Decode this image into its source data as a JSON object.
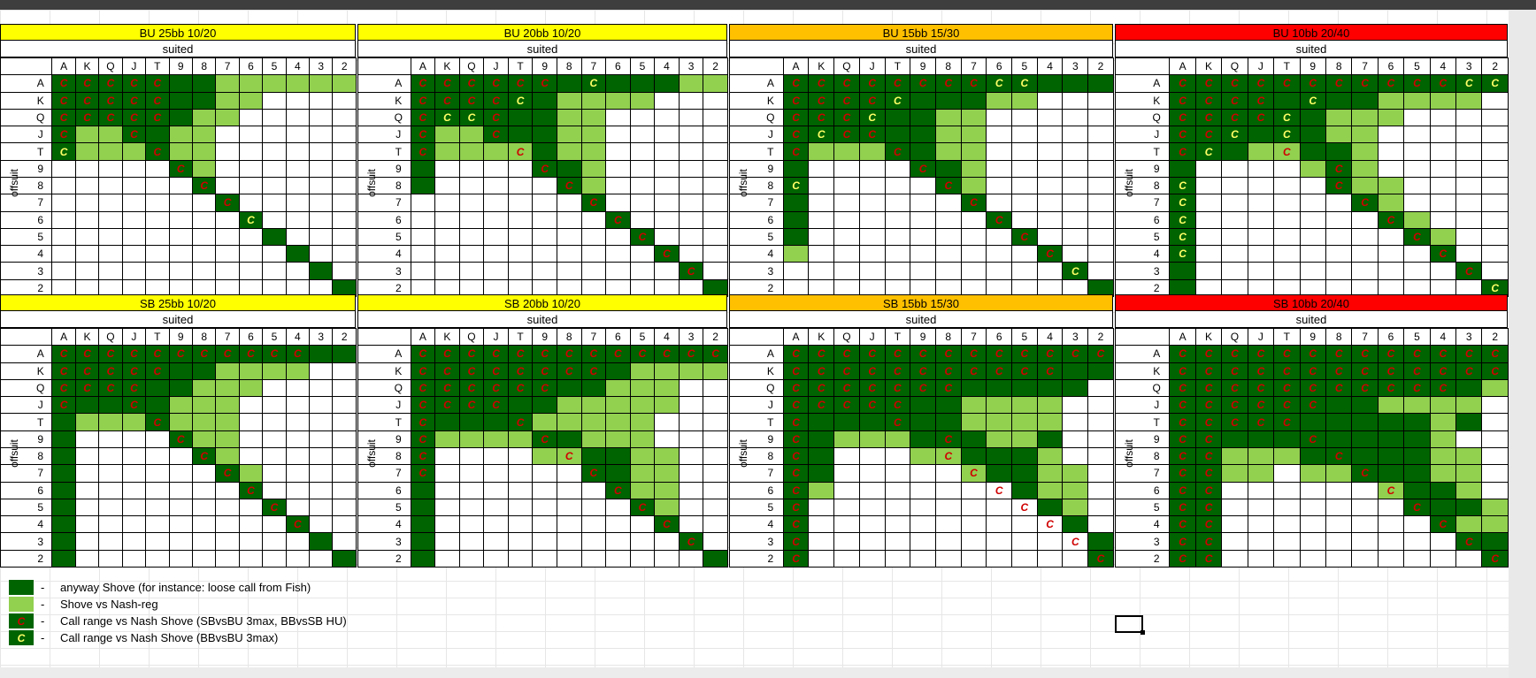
{
  "ranks": [
    "A",
    "K",
    "Q",
    "J",
    "T",
    "9",
    "8",
    "7",
    "6",
    "5",
    "4",
    "3",
    "2"
  ],
  "colors": {
    "yellow": "#ffff00",
    "orange": "#ffc000",
    "red": "#ff0000",
    "dark": "#006400",
    "light": "#92d050"
  },
  "labels": {
    "suited": "suited",
    "offsuit": "offsuit"
  },
  "panels": [
    {
      "title": "BU 25bb 10/20",
      "color": "yellow",
      "rows": [
        "DDDDDDDLLLLLL",
        "DDDDDDDLL....",
        "DDDDDDLL.....",
        "DLLDDLL......",
        "DLLLDLL......",
        ".....DL......",
        "......D......",
        ".......D.....",
        "........D....",
        ".........D...",
        "..........D..",
        "...........D.",
        "............D"
      ],
      "red": [
        [
          0,
          0
        ],
        [
          0,
          1
        ],
        [
          0,
          2
        ],
        [
          0,
          3
        ],
        [
          0,
          4
        ],
        [
          1,
          0
        ],
        [
          1,
          1
        ],
        [
          1,
          2
        ],
        [
          1,
          3
        ],
        [
          1,
          4
        ],
        [
          2,
          0
        ],
        [
          2,
          1
        ],
        [
          2,
          2
        ],
        [
          2,
          3
        ],
        [
          2,
          4
        ],
        [
          3,
          0
        ],
        [
          3,
          3
        ],
        [
          4,
          4
        ],
        [
          5,
          5
        ],
        [
          6,
          6
        ],
        [
          7,
          7
        ]
      ],
      "yel": [
        [
          4,
          0
        ],
        [
          8,
          8
        ]
      ]
    },
    {
      "title": "BU 20bb 10/20",
      "color": "yellow",
      "rows": [
        "DDDDDDDDDDDLL",
        "DDDDDDLLLL...",
        "DDDDDDLL.....",
        "DLLDDDLL.....",
        "DLLLLDLL.....",
        "D....DDL.....",
        "D.....DL.....",
        ".......D.....",
        "........D....",
        ".........D...",
        "..........D..",
        "...........D.",
        "............D"
      ],
      "red": [
        [
          0,
          0
        ],
        [
          0,
          1
        ],
        [
          0,
          2
        ],
        [
          0,
          3
        ],
        [
          0,
          4
        ],
        [
          0,
          5
        ],
        [
          1,
          0
        ],
        [
          1,
          1
        ],
        [
          1,
          2
        ],
        [
          1,
          3
        ],
        [
          2,
          0
        ],
        [
          2,
          3
        ],
        [
          3,
          0
        ],
        [
          3,
          3
        ],
        [
          4,
          0
        ],
        [
          4,
          4
        ],
        [
          5,
          5
        ],
        [
          6,
          6
        ],
        [
          7,
          7
        ],
        [
          8,
          8
        ],
        [
          9,
          9
        ],
        [
          10,
          10
        ],
        [
          11,
          11
        ]
      ],
      "yel": [
        [
          0,
          7
        ],
        [
          1,
          4
        ],
        [
          2,
          1
        ],
        [
          2,
          2
        ]
      ]
    },
    {
      "title": "BU 15bb 15/30",
      "color": "orange",
      "rows": [
        "DDDDDDDDDDDDD",
        "DDDDDDDDLL...",
        "DDDDDDLL.....",
        "DDDDDDLL.....",
        "DLLLDDLL.....",
        "D....DDL.....",
        "D.....DL.....",
        "D......D.....",
        "D.......D....",
        "D........D...",
        "L.........D..",
        "...........D.",
        "............D"
      ],
      "red": [
        [
          0,
          0
        ],
        [
          0,
          1
        ],
        [
          0,
          2
        ],
        [
          0,
          3
        ],
        [
          0,
          4
        ],
        [
          0,
          5
        ],
        [
          0,
          6
        ],
        [
          0,
          7
        ],
        [
          1,
          0
        ],
        [
          1,
          1
        ],
        [
          1,
          2
        ],
        [
          1,
          3
        ],
        [
          2,
          0
        ],
        [
          2,
          1
        ],
        [
          2,
          2
        ],
        [
          3,
          0
        ],
        [
          3,
          2
        ],
        [
          3,
          3
        ],
        [
          4,
          0
        ],
        [
          4,
          4
        ],
        [
          5,
          5
        ],
        [
          6,
          6
        ],
        [
          7,
          7
        ],
        [
          8,
          8
        ],
        [
          9,
          9
        ],
        [
          10,
          10
        ]
      ],
      "yel": [
        [
          0,
          8
        ],
        [
          0,
          9
        ],
        [
          1,
          4
        ],
        [
          2,
          3
        ],
        [
          3,
          1
        ],
        [
          6,
          0
        ],
        [
          11,
          11
        ]
      ]
    },
    {
      "title": "BU 10bb 20/40",
      "color": "red",
      "rows": [
        "DDDDDDDDDDDDD",
        "DDDDDDDDLLLL.",
        "DDDDDDLLL....",
        "DDDDDDLL.....",
        "DDDLLDDL.....",
        "D....LDL.....",
        "D.....DLL....",
        "D......DL....",
        "D.......DL...",
        "D........DL..",
        "D.........D..",
        "D..........D.",
        "D...........D"
      ],
      "red": [
        [
          0,
          0
        ],
        [
          0,
          1
        ],
        [
          0,
          2
        ],
        [
          0,
          3
        ],
        [
          0,
          4
        ],
        [
          0,
          5
        ],
        [
          0,
          6
        ],
        [
          0,
          7
        ],
        [
          0,
          8
        ],
        [
          0,
          9
        ],
        [
          0,
          10
        ],
        [
          1,
          0
        ],
        [
          1,
          1
        ],
        [
          1,
          2
        ],
        [
          1,
          3
        ],
        [
          2,
          0
        ],
        [
          2,
          1
        ],
        [
          2,
          2
        ],
        [
          2,
          3
        ],
        [
          3,
          0
        ],
        [
          3,
          1
        ],
        [
          4,
          0
        ],
        [
          4,
          4
        ],
        [
          5,
          6
        ],
        [
          6,
          6
        ],
        [
          7,
          7
        ],
        [
          8,
          8
        ],
        [
          9,
          9
        ],
        [
          10,
          10
        ],
        [
          11,
          11
        ]
      ],
      "yel": [
        [
          0,
          11
        ],
        [
          0,
          12
        ],
        [
          1,
          5
        ],
        [
          2,
          4
        ],
        [
          3,
          2
        ],
        [
          3,
          4
        ],
        [
          4,
          1
        ],
        [
          6,
          0
        ],
        [
          7,
          0
        ],
        [
          8,
          0
        ],
        [
          9,
          0
        ],
        [
          10,
          0
        ],
        [
          12,
          12
        ]
      ]
    },
    {
      "title": "SB 25bb 10/20",
      "color": "yellow",
      "rows": [
        "DDDDDDDDDDDDD",
        "DDDDDDDLLLL..",
        "DDDDDDLLL....",
        "DDDDDLLL.....",
        "DLLLDLLL.....",
        "D....DLL.....",
        "D.....DL.....",
        "D......DL....",
        "D.......D....",
        "D........D...",
        "D.........D..",
        "D..........D.",
        "D...........D"
      ],
      "red": [
        [
          0,
          0
        ],
        [
          0,
          1
        ],
        [
          0,
          2
        ],
        [
          0,
          3
        ],
        [
          0,
          4
        ],
        [
          0,
          5
        ],
        [
          0,
          6
        ],
        [
          0,
          7
        ],
        [
          0,
          8
        ],
        [
          0,
          9
        ],
        [
          0,
          10
        ],
        [
          1,
          0
        ],
        [
          1,
          1
        ],
        [
          1,
          2
        ],
        [
          1,
          3
        ],
        [
          1,
          4
        ],
        [
          2,
          0
        ],
        [
          2,
          1
        ],
        [
          2,
          2
        ],
        [
          2,
          3
        ],
        [
          3,
          0
        ],
        [
          3,
          3
        ],
        [
          4,
          4
        ],
        [
          5,
          5
        ],
        [
          6,
          6
        ],
        [
          7,
          7
        ],
        [
          8,
          8
        ],
        [
          9,
          9
        ],
        [
          10,
          10
        ]
      ],
      "yel": []
    },
    {
      "title": "SB 20bb 10/20",
      "color": "yellow",
      "rows": [
        "DDDDDDDDDDDDD",
        "DDDDDDDDDLLLL",
        "DDDDDDDDLLL..",
        "DDDDDDLLLLL..",
        "DDDDDLLLLL...",
        "DLLLLDDLLL...",
        "D....LLDDLL..",
        "D......DDLL..",
        "D.......DLL..",
        "D........DL..",
        "D.........D..",
        "D..........D.",
        "D...........D"
      ],
      "red": [
        [
          0,
          0
        ],
        [
          0,
          1
        ],
        [
          0,
          2
        ],
        [
          0,
          3
        ],
        [
          0,
          4
        ],
        [
          0,
          5
        ],
        [
          0,
          6
        ],
        [
          0,
          7
        ],
        [
          0,
          8
        ],
        [
          0,
          9
        ],
        [
          0,
          10
        ],
        [
          0,
          11
        ],
        [
          0,
          12
        ],
        [
          1,
          0
        ],
        [
          1,
          1
        ],
        [
          1,
          2
        ],
        [
          1,
          3
        ],
        [
          1,
          4
        ],
        [
          1,
          5
        ],
        [
          1,
          6
        ],
        [
          1,
          7
        ],
        [
          2,
          0
        ],
        [
          2,
          1
        ],
        [
          2,
          2
        ],
        [
          2,
          3
        ],
        [
          2,
          4
        ],
        [
          2,
          5
        ],
        [
          3,
          0
        ],
        [
          3,
          1
        ],
        [
          3,
          2
        ],
        [
          3,
          3
        ],
        [
          4,
          0
        ],
        [
          4,
          4
        ],
        [
          5,
          0
        ],
        [
          5,
          5
        ],
        [
          6,
          0
        ],
        [
          6,
          6
        ],
        [
          7,
          0
        ],
        [
          7,
          7
        ],
        [
          8,
          8
        ],
        [
          9,
          9
        ],
        [
          10,
          10
        ],
        [
          11,
          11
        ]
      ],
      "yel": []
    },
    {
      "title": "SB 15bb 15/30",
      "color": "orange",
      "rows": [
        "DDDDDDDDDDDDD",
        "DDDDDDDDDDDDD",
        "DDDDDDDDDDDD.",
        "DDDDDDDLLLL..",
        "DDDDDDDLLLL..",
        "DDLLLDDDLLD..",
        "DD...LLDDDL..",
        "DD.....LDDLL.",
        "DL.......DLL.",
        "D.........DL.",
        "D..........D.",
        "D...........D",
        "D...........D"
      ],
      "red": [
        [
          0,
          0
        ],
        [
          0,
          1
        ],
        [
          0,
          2
        ],
        [
          0,
          3
        ],
        [
          0,
          4
        ],
        [
          0,
          5
        ],
        [
          0,
          6
        ],
        [
          0,
          7
        ],
        [
          0,
          8
        ],
        [
          0,
          9
        ],
        [
          0,
          10
        ],
        [
          0,
          11
        ],
        [
          0,
          12
        ],
        [
          1,
          0
        ],
        [
          1,
          1
        ],
        [
          1,
          2
        ],
        [
          1,
          3
        ],
        [
          1,
          4
        ],
        [
          1,
          5
        ],
        [
          1,
          6
        ],
        [
          1,
          7
        ],
        [
          1,
          8
        ],
        [
          1,
          9
        ],
        [
          1,
          10
        ],
        [
          2,
          0
        ],
        [
          2,
          1
        ],
        [
          2,
          2
        ],
        [
          2,
          3
        ],
        [
          2,
          4
        ],
        [
          2,
          5
        ],
        [
          2,
          6
        ],
        [
          3,
          0
        ],
        [
          3,
          1
        ],
        [
          3,
          2
        ],
        [
          3,
          3
        ],
        [
          3,
          4
        ],
        [
          4,
          0
        ],
        [
          4,
          4
        ],
        [
          5,
          0
        ],
        [
          5,
          6
        ],
        [
          6,
          0
        ],
        [
          6,
          6
        ],
        [
          7,
          0
        ],
        [
          7,
          7
        ],
        [
          8,
          0
        ],
        [
          8,
          8
        ],
        [
          9,
          0
        ],
        [
          9,
          9
        ],
        [
          10,
          0
        ],
        [
          10,
          10
        ],
        [
          11,
          0
        ],
        [
          11,
          11
        ],
        [
          12,
          0
        ],
        [
          12,
          12
        ]
      ],
      "yel": []
    },
    {
      "title": "SB 10bb 20/40",
      "color": "red",
      "rows": [
        "DDDDDDDDDDDDD",
        "DDDDDDDDDDDDD",
        "DDDDDDDDDDDDL",
        "DDDDDDDDLLLL.",
        "DDDDDDDDDDLD.",
        "DDDDDDDDDDL..",
        "DDLLLDDDDDLL.",
        "DDLL.LLDDDLL.",
        "DD......LDDL.",
        "DD.......DDDL",
        "DD........DLL",
        "DD.........DD",
        "DD..........D"
      ],
      "red": [
        [
          0,
          0
        ],
        [
          0,
          1
        ],
        [
          0,
          2
        ],
        [
          0,
          3
        ],
        [
          0,
          4
        ],
        [
          0,
          5
        ],
        [
          0,
          6
        ],
        [
          0,
          7
        ],
        [
          0,
          8
        ],
        [
          0,
          9
        ],
        [
          0,
          10
        ],
        [
          0,
          11
        ],
        [
          0,
          12
        ],
        [
          1,
          0
        ],
        [
          1,
          1
        ],
        [
          1,
          2
        ],
        [
          1,
          3
        ],
        [
          1,
          4
        ],
        [
          1,
          5
        ],
        [
          1,
          6
        ],
        [
          1,
          7
        ],
        [
          1,
          8
        ],
        [
          1,
          9
        ],
        [
          1,
          10
        ],
        [
          1,
          11
        ],
        [
          1,
          12
        ],
        [
          2,
          0
        ],
        [
          2,
          1
        ],
        [
          2,
          2
        ],
        [
          2,
          3
        ],
        [
          2,
          4
        ],
        [
          2,
          5
        ],
        [
          2,
          6
        ],
        [
          2,
          7
        ],
        [
          2,
          8
        ],
        [
          2,
          9
        ],
        [
          2,
          10
        ],
        [
          3,
          0
        ],
        [
          3,
          1
        ],
        [
          3,
          2
        ],
        [
          3,
          3
        ],
        [
          3,
          4
        ],
        [
          3,
          5
        ],
        [
          4,
          0
        ],
        [
          4,
          1
        ],
        [
          4,
          2
        ],
        [
          4,
          3
        ],
        [
          4,
          4
        ],
        [
          5,
          0
        ],
        [
          5,
          1
        ],
        [
          5,
          5
        ],
        [
          6,
          0
        ],
        [
          6,
          1
        ],
        [
          6,
          6
        ],
        [
          7,
          0
        ],
        [
          7,
          1
        ],
        [
          7,
          7
        ],
        [
          8,
          0
        ],
        [
          8,
          1
        ],
        [
          8,
          8
        ],
        [
          9,
          0
        ],
        [
          9,
          1
        ],
        [
          9,
          9
        ],
        [
          10,
          0
        ],
        [
          10,
          1
        ],
        [
          10,
          10
        ],
        [
          11,
          0
        ],
        [
          11,
          1
        ],
        [
          11,
          11
        ],
        [
          12,
          0
        ],
        [
          12,
          1
        ],
        [
          12,
          12
        ]
      ],
      "yel": []
    }
  ],
  "legend": [
    {
      "swatch": "dark",
      "mark": "",
      "text": "anyway Shove (for instance: loose call from Fish)"
    },
    {
      "swatch": "light",
      "mark": "",
      "text": "Shove vs Nash-reg"
    },
    {
      "swatch": "dark",
      "mark": "red",
      "text": "Call range vs Nash Shove (SBvsBU 3max, BBvsSB HU)"
    },
    {
      "swatch": "dark",
      "mark": "yel",
      "text": "Call range vs Nash Shove (BBvsBU 3max)"
    }
  ],
  "legend_dash": "-",
  "call_mark": "C"
}
